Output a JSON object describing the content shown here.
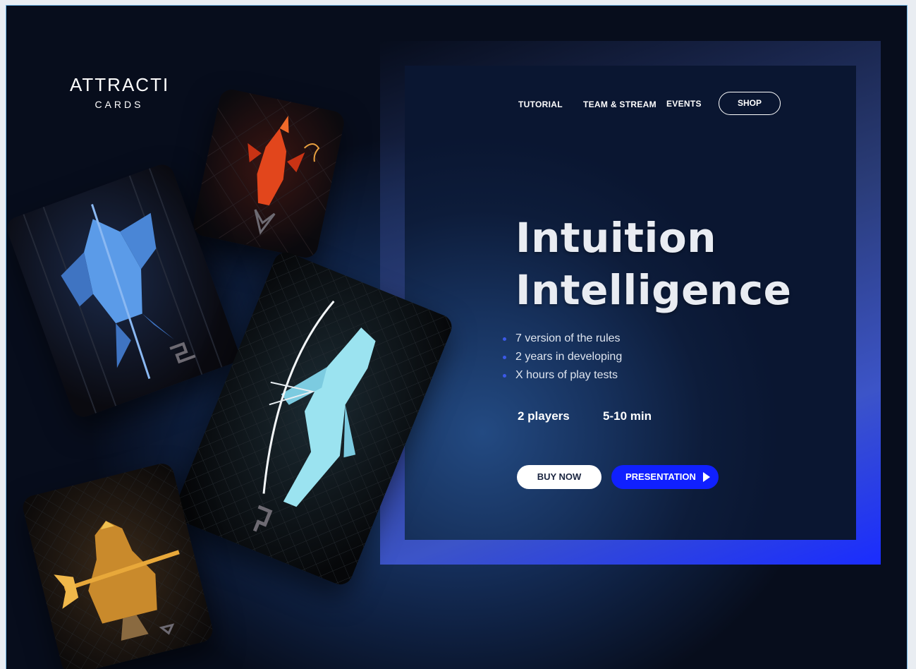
{
  "brand": {
    "name": "ATTRACTI",
    "sub": "CARDS"
  },
  "nav": {
    "items": [
      "TUTORIAL",
      "TEAM & STREAM",
      "EVENTS"
    ],
    "shop": "SHOP"
  },
  "hero": {
    "title_line1": "Intuition",
    "title_line2": "Intelligence",
    "features": [
      "7 version of the rules",
      "2 years in developing",
      "X hours of play tests"
    ],
    "players": "2 players",
    "duration": "5-10 min",
    "buy_label": "BUY NOW",
    "presentation_label": "PRESENTATION"
  },
  "colors": {
    "accent": "#1020ff",
    "background": "#0e1f3f",
    "bullet": "#3b59e8"
  },
  "cards": [
    {
      "name": "blue-warrior-card",
      "figure_color": "#5b9be8"
    },
    {
      "name": "fire-mage-card",
      "figure_color": "#e2461c"
    },
    {
      "name": "ice-archer-card",
      "figure_color": "#9be3f0"
    },
    {
      "name": "gold-executioner-card",
      "figure_color": "#e8a83a"
    }
  ]
}
